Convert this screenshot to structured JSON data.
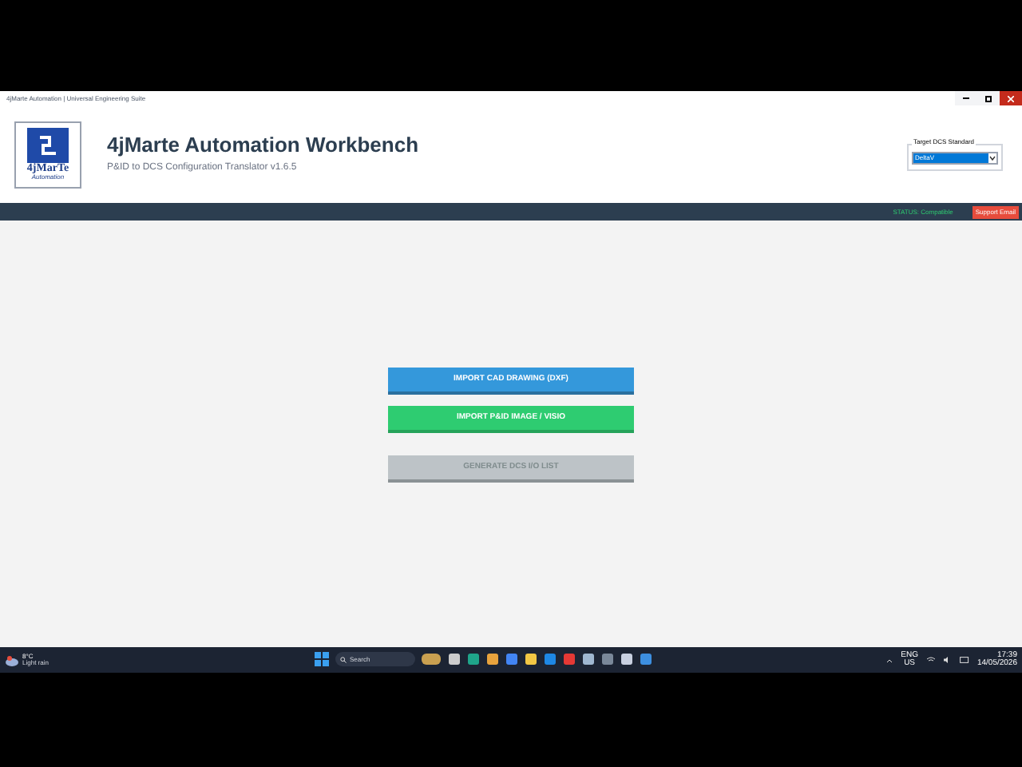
{
  "window": {
    "title": "4jMarte Automation | Universal Engineering Suite"
  },
  "header": {
    "logo_text": "4jMarTe",
    "logo_subtext": "Automation",
    "title": "4jMarte Automation Workbench",
    "subtitle": "P&ID to DCS Configuration Translator v1.6.5",
    "dcs_group": {
      "label": "Target DCS Standard",
      "value": "DeltaV"
    }
  },
  "status_bar": {
    "status": "STATUS: Compatible",
    "support": "Support Email"
  },
  "buttons": [
    {
      "label": "IMPORT CAD DRAWING (DXF)",
      "kind": "primary",
      "disabled": false
    },
    {
      "label": "IMPORT P&ID IMAGE / VISIO",
      "kind": "success",
      "disabled": false
    },
    {
      "label": "GENERATE DCS I/O LIST",
      "disabled": true
    }
  ],
  "taskbar": {
    "weather_temp": "8°C",
    "weather_desc": "Light rain",
    "search": "Search",
    "lang": "ENG",
    "region": "US",
    "time": "17:39",
    "date": "14/05/2026"
  }
}
